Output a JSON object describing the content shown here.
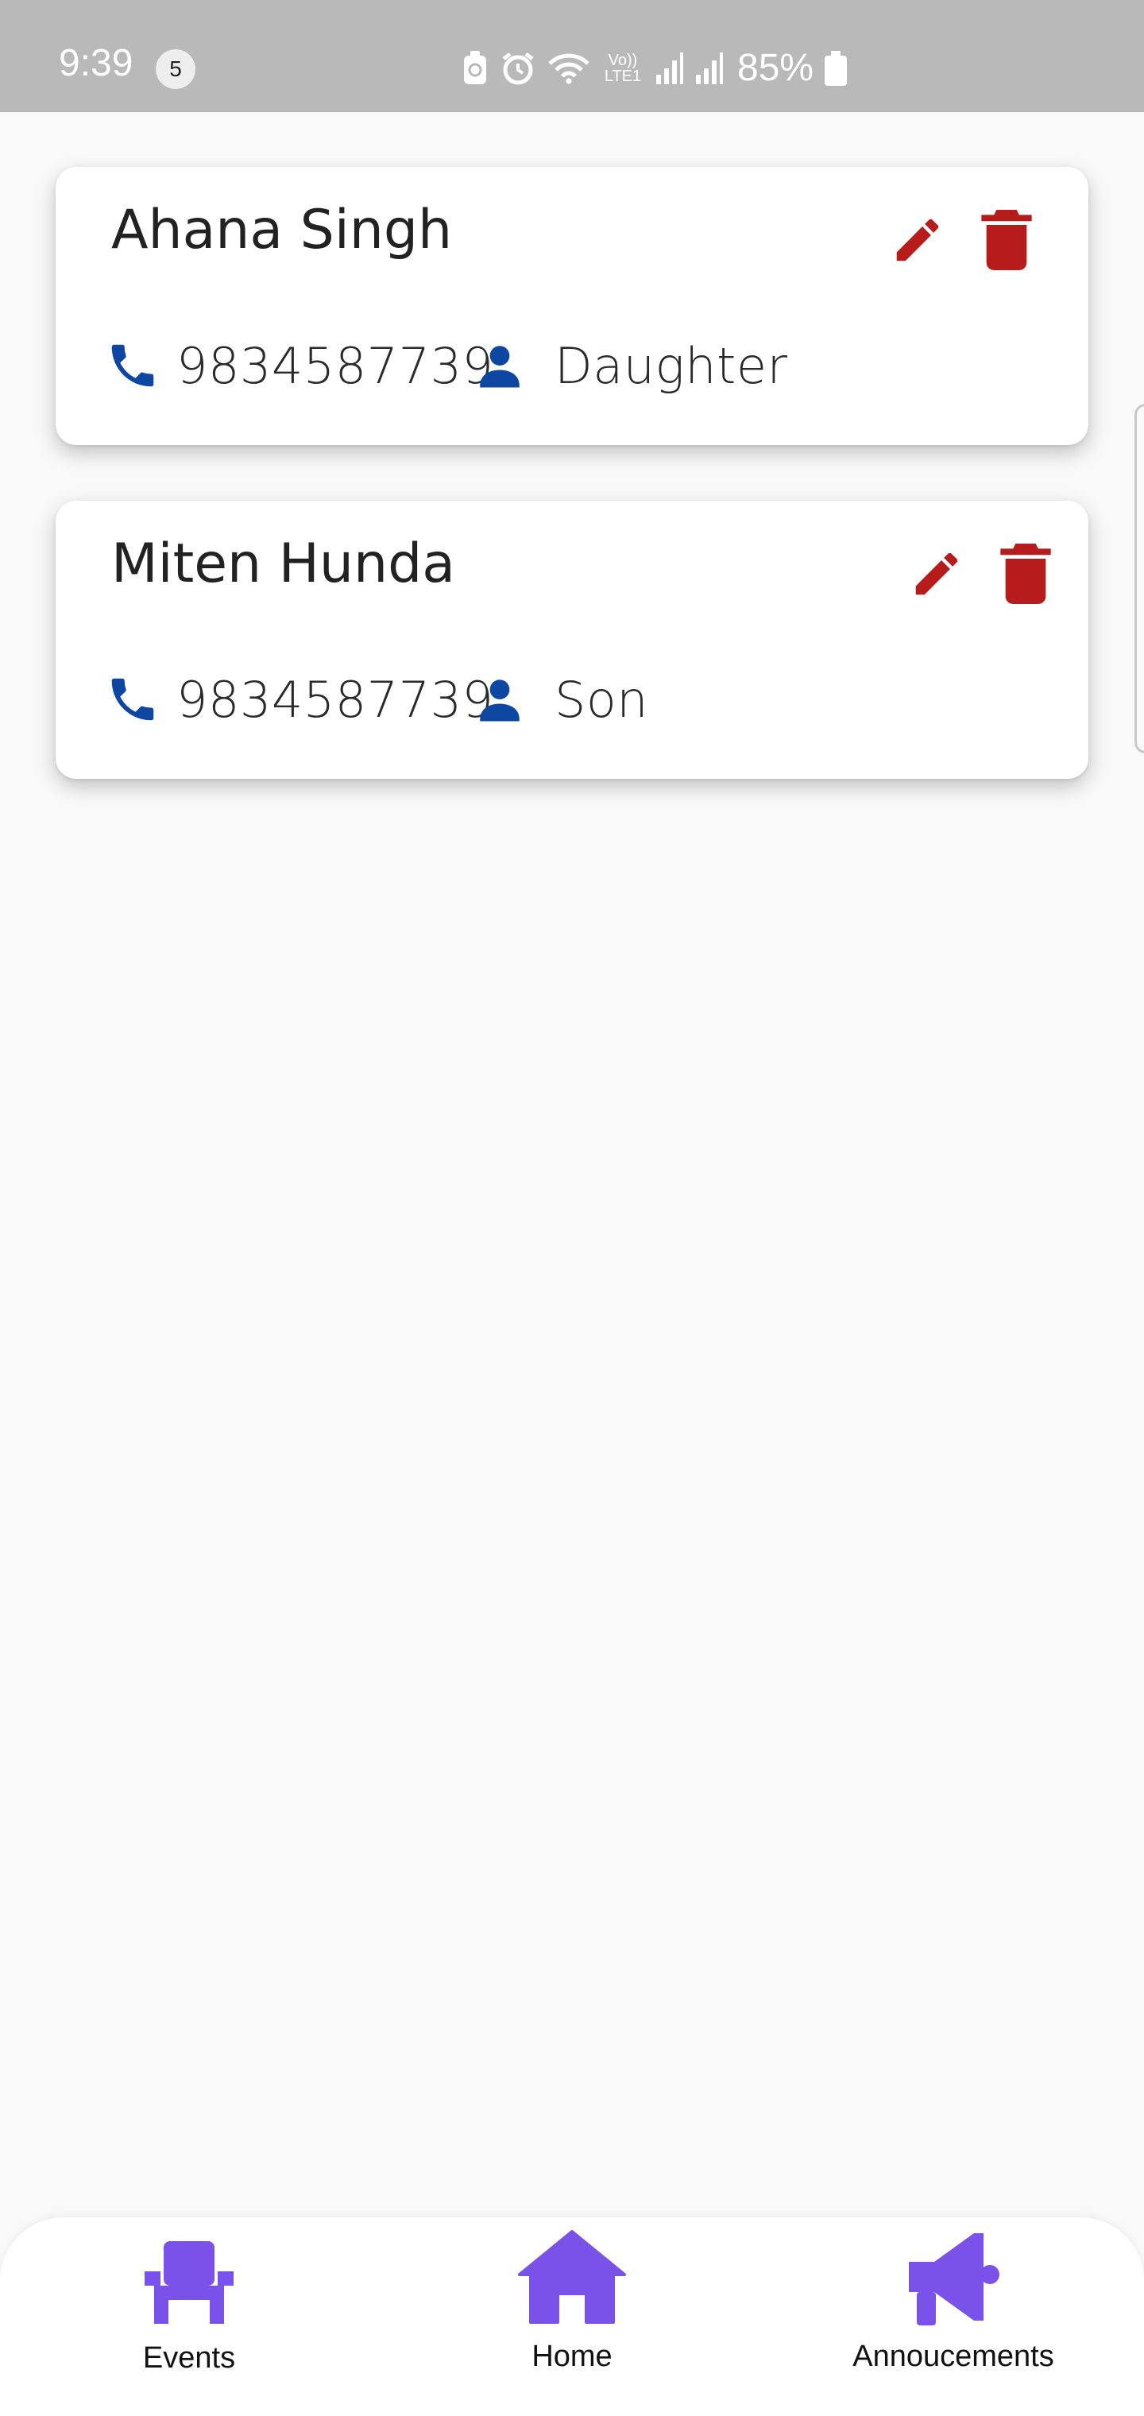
{
  "status_bar": {
    "time": "9:39",
    "notification_count": "5",
    "battery": "85%",
    "network_label": "Vo)) LTE1"
  },
  "contacts": [
    {
      "name": "Ahana Singh",
      "phone": "9834587739",
      "relation": "Daughter"
    },
    {
      "name": "Miten Hunda",
      "phone": "9834587739",
      "relation": "Son"
    }
  ],
  "bottom_nav": {
    "events": "Events",
    "home": "Home",
    "announcements": "Annoucements"
  },
  "colors": {
    "accent": "#7a52ea",
    "action_red": "#b71c1c",
    "info_blue": "#0d47a1",
    "status_bar": "#b9b9b9"
  },
  "icons": {
    "edit": "pencil-icon",
    "delete": "trash-icon",
    "phone": "phone-icon",
    "relation": "person-icon",
    "events": "chair-icon",
    "home": "home-icon",
    "announcements": "megaphone-icon"
  }
}
